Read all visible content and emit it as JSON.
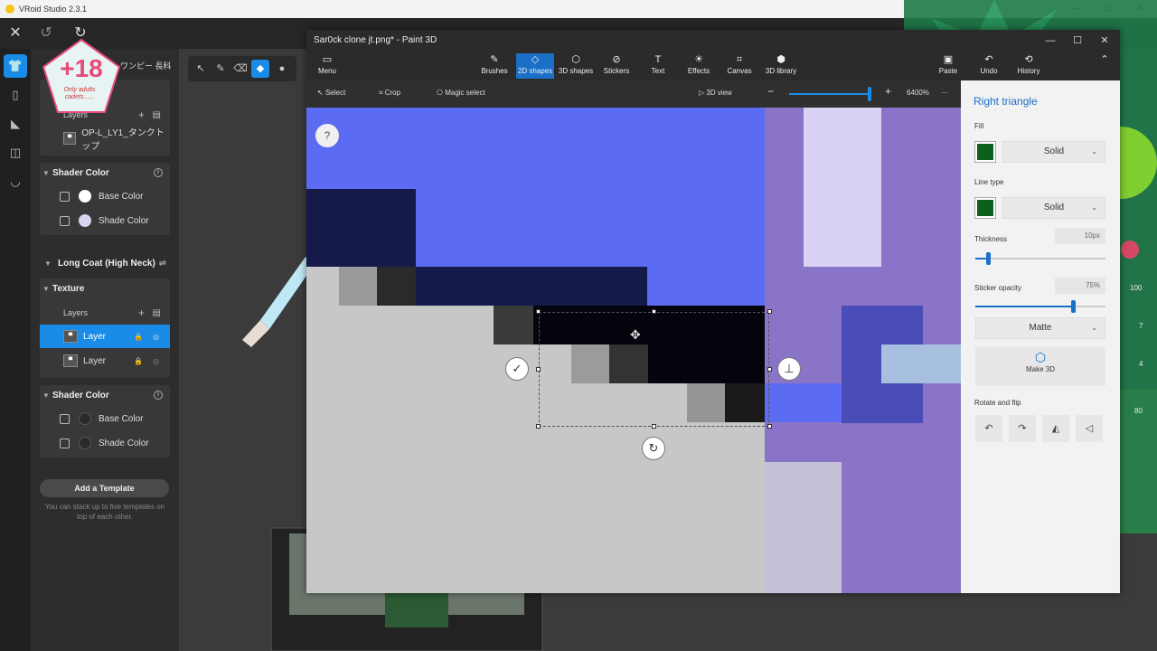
{
  "vroid": {
    "title": "VRoid Studio 2.3.1",
    "sidebar_label_top": "ワンピー 長科",
    "badge": {
      "title": "+18",
      "subtitle": "Only adults cadets......"
    },
    "sections": {
      "top_layers": {
        "label": "Layers",
        "layer_name": "OP-L_LY1_タンクトップ"
      },
      "shader1": {
        "title": "Shader Color",
        "base": "Base Color",
        "shade": "Shade Color"
      },
      "coat": {
        "title": "Long Coat (High Neck)"
      },
      "texture": {
        "title": "Texture",
        "layers_label": "Layers",
        "layer1": "Layer",
        "layer2": "Layer"
      },
      "shader2": {
        "title": "Shader Color",
        "base": "Base Color",
        "shade": "Shade Color"
      }
    },
    "add_template": "Add a Template",
    "template_note": "You can stack up to five templates on top of each other.",
    "colors": {
      "accent": "#1a8ce8",
      "shade1": "#d8d3f0",
      "base1": "#ffffff"
    }
  },
  "paint3d": {
    "title": "Sar0ck clone jt.png* - Paint 3D",
    "menu_label": "Menu",
    "ribbon": [
      "Brushes",
      "2D shapes",
      "3D shapes",
      "Stickers",
      "Text",
      "Effects",
      "Canvas",
      "3D library"
    ],
    "ribbon_right": [
      "Paste",
      "Undo",
      "History"
    ],
    "active_tool": "2D shapes",
    "subbar": {
      "select": "Select",
      "crop": "Crop",
      "magic_select": "Magic select",
      "view3d": "3D view",
      "zoom": "6400%"
    },
    "help": "?",
    "panel": {
      "title": "Right triangle",
      "fill_label": "Fill",
      "fill_value": "Solid",
      "line_label": "Line type",
      "line_value": "Solid",
      "thickness_label": "Thickness",
      "thickness_value": "10px",
      "thickness_level": 0.1,
      "opacity_label": "Sticker opacity",
      "opacity_value": "75%",
      "opacity_level": 0.75,
      "finish_value": "Matte",
      "make3d": "Make 3D",
      "rotate_label": "Rotate and flip",
      "fill_color": "#0e5f1b"
    },
    "side_numbers": [
      "100",
      "7",
      "4",
      "80"
    ]
  }
}
